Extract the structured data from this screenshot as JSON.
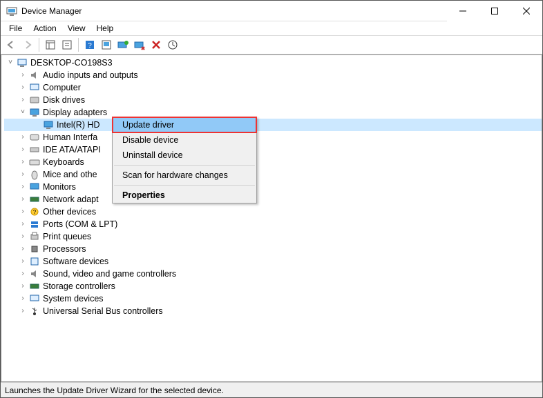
{
  "window": {
    "title": "Device Manager"
  },
  "menu": {
    "file": "File",
    "action": "Action",
    "view": "View",
    "help": "Help"
  },
  "tree": {
    "root": "DESKTOP-CO198S3",
    "items": [
      "Audio inputs and outputs",
      "Computer",
      "Disk drives",
      "Display adapters",
      "Intel(R) HD",
      "Human Interfa",
      "IDE ATA/ATAPI",
      "Keyboards",
      "Mice and othe",
      "Monitors",
      "Network adapt",
      "Other devices",
      "Ports (COM & LPT)",
      "Print queues",
      "Processors",
      "Software devices",
      "Sound, video and game controllers",
      "Storage controllers",
      "System devices",
      "Universal Serial Bus controllers"
    ]
  },
  "ctx": {
    "update": "Update driver",
    "disable": "Disable device",
    "uninstall": "Uninstall device",
    "scan": "Scan for hardware changes",
    "props": "Properties"
  },
  "status": "Launches the Update Driver Wizard for the selected device."
}
